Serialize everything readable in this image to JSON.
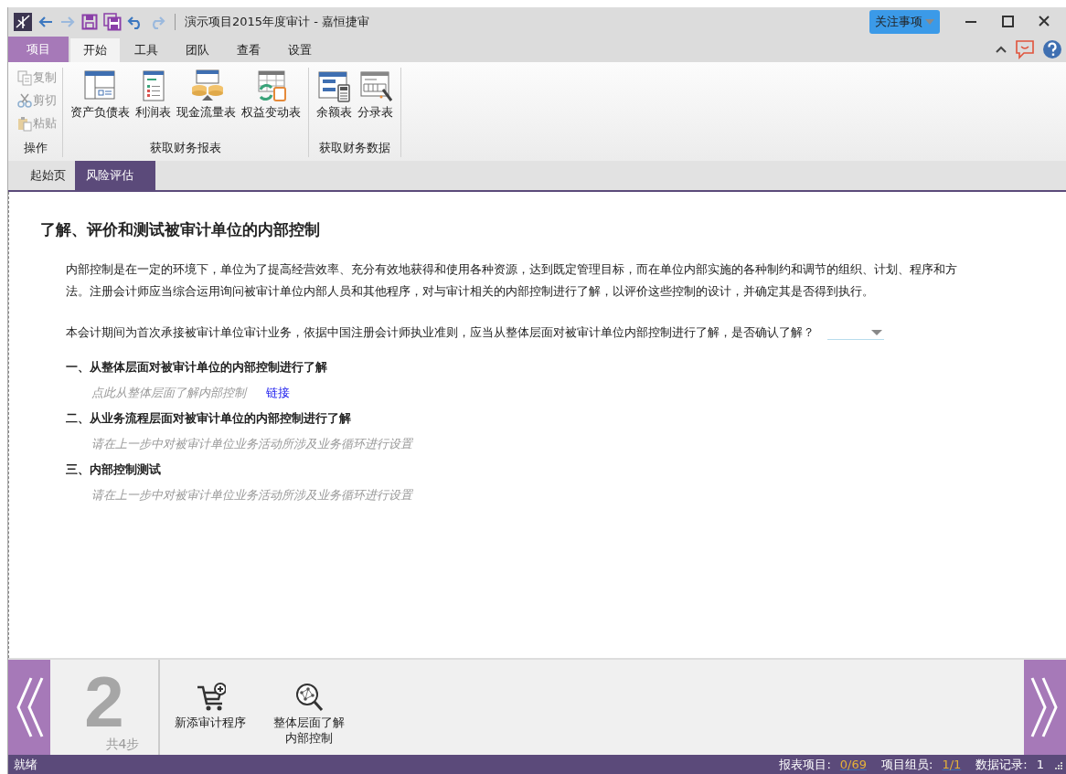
{
  "window": {
    "title": "演示项目2015年度审计 - 嘉恒捷审",
    "attention_button": "关注事项"
  },
  "ribbon": {
    "tabs": [
      {
        "label": "项目",
        "kind": "file",
        "selected": false
      },
      {
        "label": "开始",
        "kind": "tab",
        "selected": true
      },
      {
        "label": "工具",
        "kind": "tab",
        "selected": false
      },
      {
        "label": "团队",
        "kind": "tab",
        "selected": false
      },
      {
        "label": "查看",
        "kind": "tab",
        "selected": false
      },
      {
        "label": "设置",
        "kind": "tab",
        "selected": false
      }
    ],
    "groups": [
      {
        "label": "操作",
        "kind": "small",
        "items": [
          {
            "label": "复制",
            "disabled": true
          },
          {
            "label": "剪切",
            "disabled": true
          },
          {
            "label": "粘贴",
            "disabled": true
          }
        ]
      },
      {
        "label": "获取财务报表",
        "kind": "large",
        "items": [
          {
            "label": "资产负债表"
          },
          {
            "label": "利润表"
          },
          {
            "label": "现金流量表"
          },
          {
            "label": "权益变动表"
          }
        ]
      },
      {
        "label": "获取财务数据",
        "kind": "large",
        "items": [
          {
            "label": "余额表"
          },
          {
            "label": "分录表"
          }
        ]
      }
    ]
  },
  "doc_tabs": [
    {
      "label": "起始页",
      "selected": false
    },
    {
      "label": "风险评估",
      "selected": true
    }
  ],
  "content": {
    "title": "了解、评价和测试被审计单位的内部控制",
    "paragraph": "内部控制是在一定的环境下，单位为了提高经营效率、充分有效地获得和使用各种资源，达到既定管理目标，而在单位内部实施的各种制约和调节的组织、计划、程序和方法。注册会计师应当综合运用询问被审计单位内部人员和其他程序，对与审计相关的内部控制进行了解，以评价这些控制的设计，并确定其是否得到执行。",
    "question": "本会计期间为首次承接被审计单位审计业务，依据中国注册会计师执业准则，应当从整体层面对被审计单位内部控制进行了解，是否确认了解？",
    "sections": [
      {
        "heading": "一、从整体层面对被审计单位的内部控制进行了解",
        "note": "点此从整体层面了解内部控制",
        "link": "链接"
      },
      {
        "heading": "二、从业务流程层面对被审计单位的内部控制进行了解",
        "note": "请在上一步中对被审计单位业务活动所涉及业务循环进行设置"
      },
      {
        "heading": "三、内部控制测试",
        "note": "请在上一步中对被审计单位业务活动所涉及业务循环进行设置"
      }
    ]
  },
  "step_bar": {
    "step": "2",
    "total": "共4步",
    "actions": [
      {
        "lines": [
          "新添审计程序"
        ]
      },
      {
        "lines": [
          "整体层面了解",
          "内部控制"
        ]
      }
    ]
  },
  "status_bar": {
    "state": "就绪",
    "stats": [
      {
        "label": "报表项目:",
        "value": "0/69",
        "kind": "link"
      },
      {
        "label": "项目组员:",
        "value": "1/1",
        "kind": "link"
      },
      {
        "label": "数据记录:",
        "value": "1",
        "kind": "plain"
      }
    ]
  }
}
